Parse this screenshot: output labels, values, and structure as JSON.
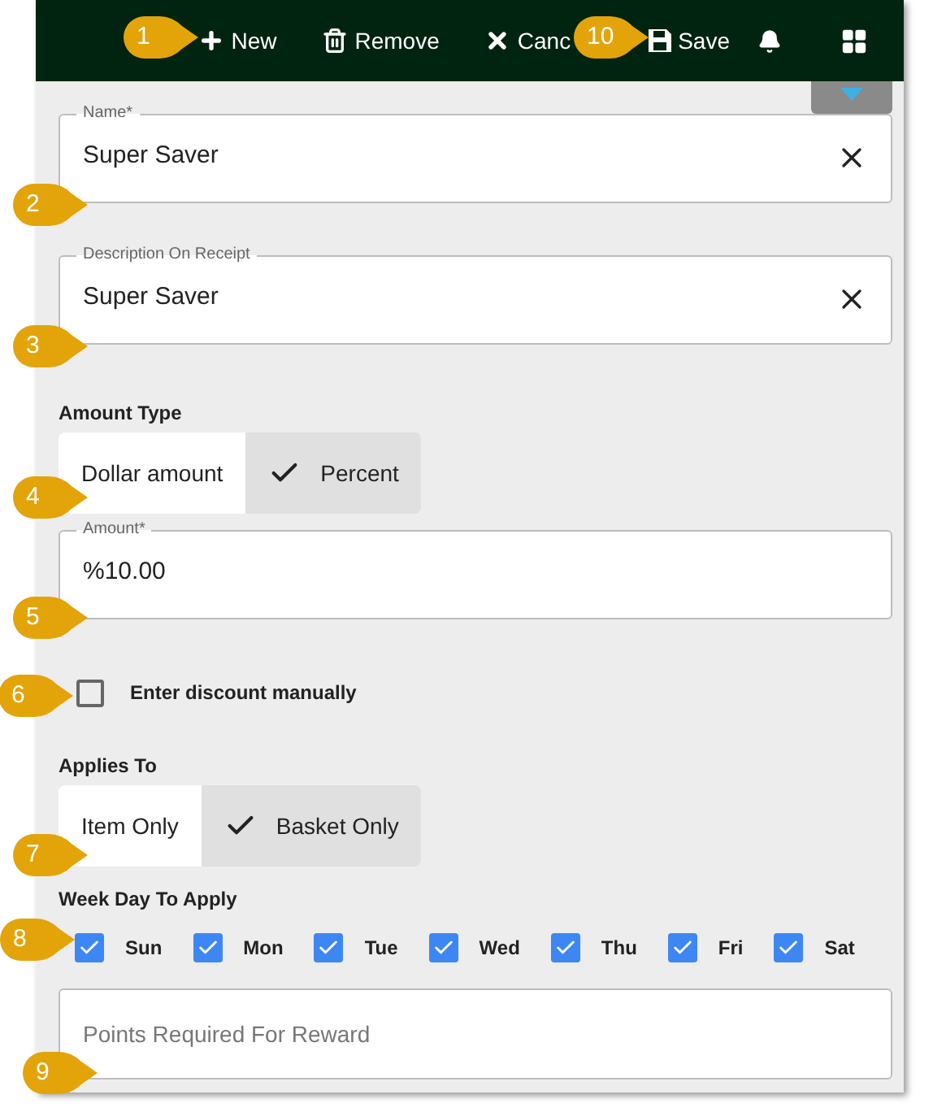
{
  "toolbar": [
    {
      "kind": "new",
      "label": "New"
    },
    {
      "kind": "remove",
      "label": "Remove"
    },
    {
      "kind": "cancel",
      "label": "Canc"
    },
    {
      "kind": "save",
      "label": "Save"
    },
    {
      "kind": "bell"
    },
    {
      "kind": "grid"
    }
  ],
  "name_field": {
    "label": "Name*",
    "value": "Super Saver"
  },
  "description_field": {
    "label": "Description On Receipt",
    "value": "Super Saver"
  },
  "amount_type": {
    "label": "Amount Type",
    "options": [
      {
        "label": "Dollar amount",
        "selected": false
      },
      {
        "label": "Percent",
        "selected": true
      }
    ]
  },
  "amount_field": {
    "label": "Amount*",
    "value": "%10.00"
  },
  "enter_manually": {
    "label": "Enter discount manually",
    "checked": false
  },
  "applies_to": {
    "label": "Applies To",
    "options": [
      {
        "label": "Item Only",
        "selected": false
      },
      {
        "label": "Basket Only",
        "selected": true
      }
    ]
  },
  "week_days": {
    "label": "Week Day To Apply",
    "days": [
      {
        "label": "Sun",
        "checked": true
      },
      {
        "label": "Mon",
        "checked": true
      },
      {
        "label": "Tue",
        "checked": true
      },
      {
        "label": "Wed",
        "checked": true
      },
      {
        "label": "Thu",
        "checked": true
      },
      {
        "label": "Fri",
        "checked": true
      },
      {
        "label": "Sat",
        "checked": true
      }
    ]
  },
  "points_field": {
    "placeholder": "Points Required For Reward"
  },
  "callouts": [
    "1",
    "10",
    "2",
    "3",
    "4",
    "5",
    "6",
    "7",
    "8",
    "9"
  ]
}
